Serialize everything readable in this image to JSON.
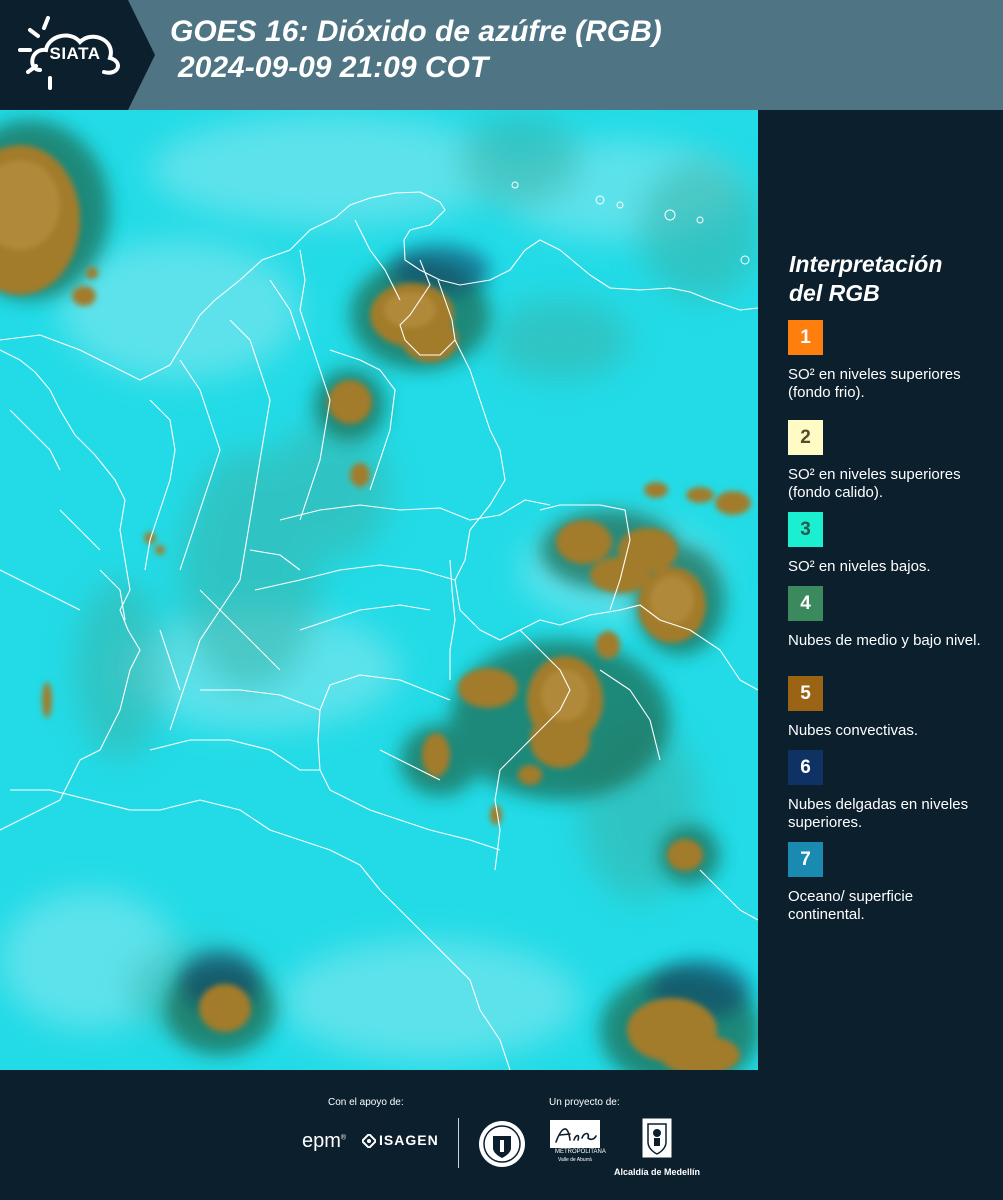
{
  "header": {
    "logo_text": "SIATA",
    "title_line1": "GOES 16: Dióxido de azúfre (RGB)",
    "title_line2": "2024-09-09 21:09 COT"
  },
  "map": {
    "base_color": "#1dd9e4",
    "border_color": "#ffffff"
  },
  "legend": {
    "title_line1": "Interpretación",
    "title_line2": "del RGB",
    "items": [
      {
        "number": "1",
        "label": "SO² en niveles superiores (fondo frio).",
        "color": "#ff7f0e",
        "text_color": "#ffffff"
      },
      {
        "number": "2",
        "label": "SO² en niveles superiores (fondo calido).",
        "color": "#fffbc4",
        "text_color": "#5a4a2a"
      },
      {
        "number": "3",
        "label": "SO² en niveles bajos.",
        "color": "#1af0d0",
        "text_color": "#2a5a50"
      },
      {
        "number": "4",
        "label": "Nubes de medio y bajo nivel.",
        "color": "#3a8a5e",
        "text_color": "#ffffff"
      },
      {
        "number": "5",
        "label": "Nubes convectivas.",
        "color": "#9a6414",
        "text_color": "#ffffff"
      },
      {
        "number": "6",
        "label": "Nubes delgadas en niveles superiores.",
        "color": "#0e3264",
        "text_color": "#ffffff"
      },
      {
        "number": "7",
        "label": "Oceano/ superficie continental.",
        "color": "#1a8ab0",
        "text_color": "#ffffff"
      }
    ]
  },
  "footer": {
    "support_label": "Con el apoyo de:",
    "project_label": "Un proyecto de:",
    "epm": "epm",
    "isagen": "ISAGEN",
    "area_line1": "METROPOLITANA",
    "area_line2": "Valle de Aburrá",
    "alcaldia": "Alcaldía de Medellín"
  }
}
